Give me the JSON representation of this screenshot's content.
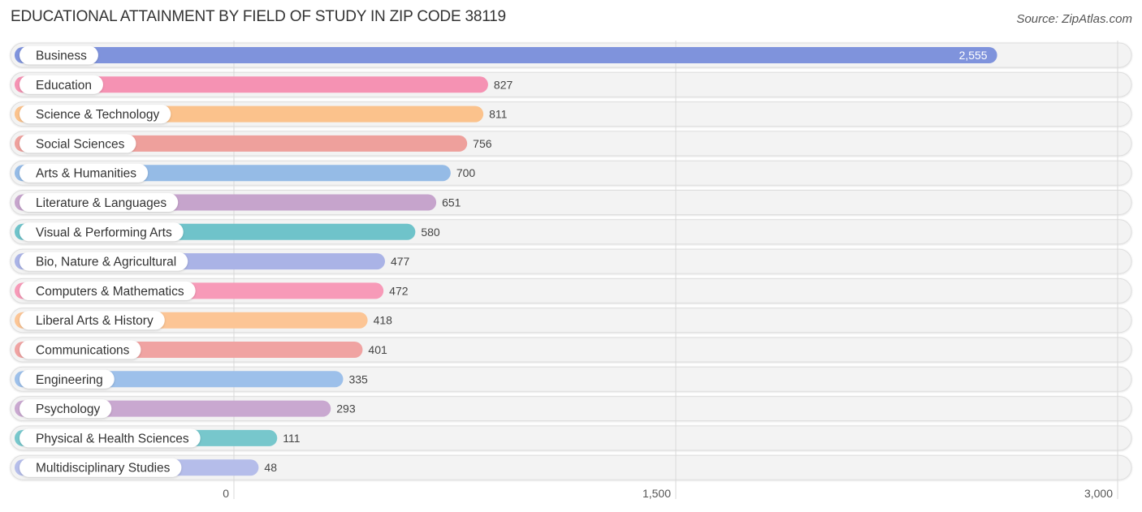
{
  "header": {
    "title": "EDUCATIONAL ATTAINMENT BY FIELD OF STUDY IN ZIP CODE 38119",
    "source": "Source: ZipAtlas.com"
  },
  "chart_data": {
    "type": "bar",
    "orientation": "horizontal",
    "title": "EDUCATIONAL ATTAINMENT BY FIELD OF STUDY IN ZIP CODE 38119",
    "xlabel": "",
    "ylabel": "",
    "xlim": [
      0,
      3000
    ],
    "xticks": [
      0,
      1500,
      3000
    ],
    "xtick_labels": [
      "0",
      "1,500",
      "3,000"
    ],
    "grid": true,
    "legend": "none",
    "categories": [
      "Business",
      "Education",
      "Science & Technology",
      "Social Sciences",
      "Arts & Humanities",
      "Literature & Languages",
      "Visual & Performing Arts",
      "Bio, Nature & Agricultural",
      "Computers & Mathematics",
      "Liberal Arts & History",
      "Communications",
      "Engineering",
      "Psychology",
      "Physical & Health Sciences",
      "Multidisciplinary Studies"
    ],
    "values": [
      2555,
      827,
      811,
      756,
      700,
      651,
      580,
      477,
      472,
      418,
      401,
      335,
      293,
      111,
      48
    ],
    "value_labels": [
      "2,555",
      "827",
      "811",
      "756",
      "700",
      "651",
      "580",
      "477",
      "472",
      "418",
      "401",
      "335",
      "293",
      "111",
      "48"
    ],
    "colors": [
      "#7f93dc",
      "#f592b3",
      "#fbc28c",
      "#eea09c",
      "#95bbe6",
      "#c6a4cc",
      "#6fc3ca",
      "#aab3e6",
      "#f79ab8",
      "#fcc595",
      "#f0a3a2",
      "#9dc0ea",
      "#c9a8d0",
      "#77c7cc",
      "#b5bdea"
    ]
  }
}
